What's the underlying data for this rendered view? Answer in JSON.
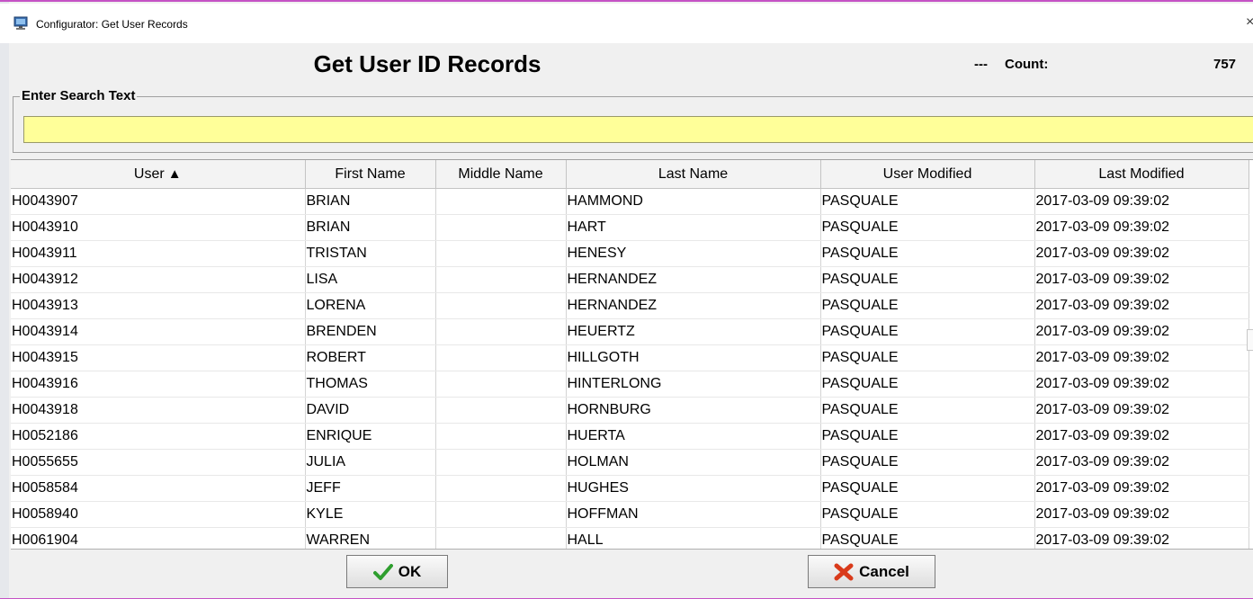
{
  "window": {
    "title": "Configurator: Get User Records",
    "close_glyph": "×"
  },
  "header": {
    "title": "Get User ID Records",
    "count_prefix": "---",
    "count_label": "Count:",
    "count_value": "757"
  },
  "search": {
    "legend": "Enter Search Text",
    "value": "",
    "placeholder": ""
  },
  "table": {
    "columns": [
      "User",
      "First Name",
      "Middle Name",
      "Last Name",
      "User Modified",
      "Last Modified"
    ],
    "sort_indicator": "▲",
    "rows": [
      [
        "H0043907",
        "BRIAN",
        "",
        "HAMMOND",
        "PASQUALE",
        "2017-03-09 09:39:02"
      ],
      [
        "H0043910",
        "BRIAN",
        "",
        "HART",
        "PASQUALE",
        "2017-03-09 09:39:02"
      ],
      [
        "H0043911",
        "TRISTAN",
        "",
        "HENESY",
        "PASQUALE",
        "2017-03-09 09:39:02"
      ],
      [
        "H0043912",
        "LISA",
        "",
        "HERNANDEZ",
        "PASQUALE",
        "2017-03-09 09:39:02"
      ],
      [
        "H0043913",
        "LORENA",
        "",
        "HERNANDEZ",
        "PASQUALE",
        "2017-03-09 09:39:02"
      ],
      [
        "H0043914",
        "BRENDEN",
        "",
        "HEUERTZ",
        "PASQUALE",
        "2017-03-09 09:39:02"
      ],
      [
        "H0043915",
        "ROBERT",
        "",
        "HILLGOTH",
        "PASQUALE",
        "2017-03-09 09:39:02"
      ],
      [
        "H0043916",
        "THOMAS",
        "",
        "HINTERLONG",
        "PASQUALE",
        "2017-03-09 09:39:02"
      ],
      [
        "H0043918",
        "DAVID",
        "",
        "HORNBURG",
        "PASQUALE",
        "2017-03-09 09:39:02"
      ],
      [
        "H0052186",
        "ENRIQUE",
        "",
        "HUERTA",
        "PASQUALE",
        "2017-03-09 09:39:02"
      ],
      [
        "H0055655",
        "JULIA",
        "",
        "HOLMAN",
        "PASQUALE",
        "2017-03-09 09:39:02"
      ],
      [
        "H0058584",
        "JEFF",
        "",
        "HUGHES",
        "PASQUALE",
        "2017-03-09 09:39:02"
      ],
      [
        "H0058940",
        "KYLE",
        "",
        "HOFFMAN",
        "PASQUALE",
        "2017-03-09 09:39:02"
      ],
      [
        "H0061904",
        "WARREN",
        "",
        "HALL",
        "PASQUALE",
        "2017-03-09 09:39:02"
      ]
    ]
  },
  "buttons": {
    "ok_label": "OK",
    "ok_icon": "checkmark-icon",
    "cancel_label": "Cancel",
    "cancel_icon": "x-icon"
  },
  "colors": {
    "search_background": "#ffff99",
    "window_border": "#c552c5",
    "ok_check": "#2e9e2e",
    "cancel_x": "#d93a1a"
  }
}
